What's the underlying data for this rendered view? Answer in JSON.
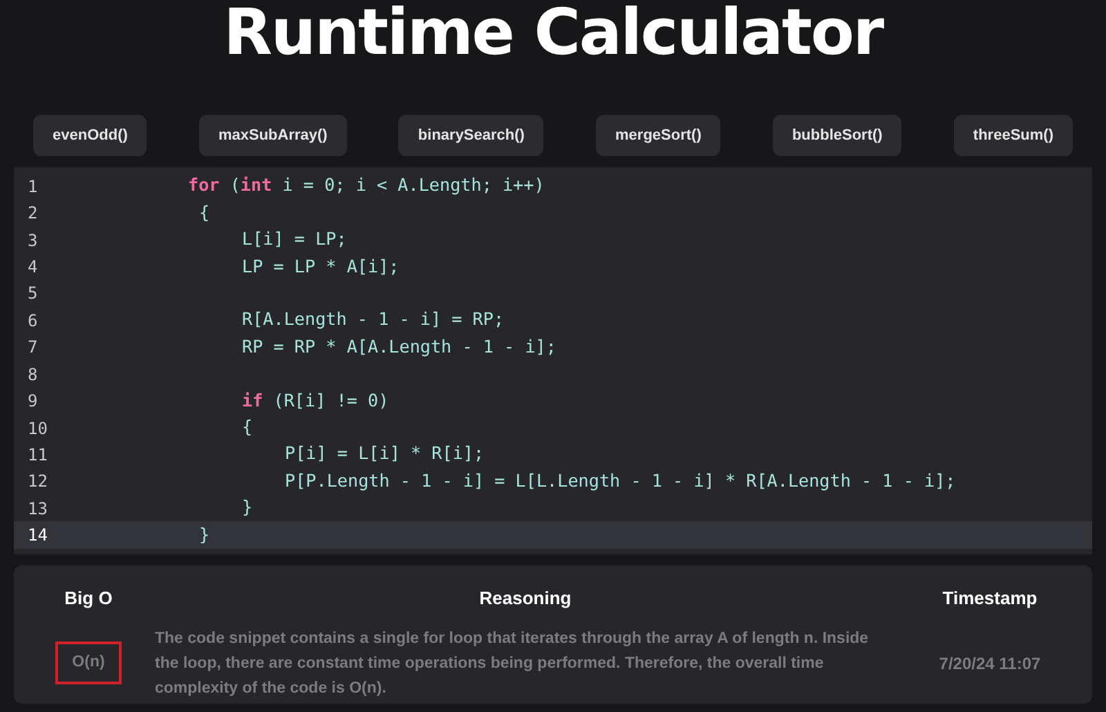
{
  "title": "Runtime Calculator",
  "examples": [
    {
      "label": "evenOdd()"
    },
    {
      "label": "maxSubArray()"
    },
    {
      "label": "binarySearch()"
    },
    {
      "label": "mergeSort()"
    },
    {
      "label": "bubbleSort()"
    },
    {
      "label": "threeSum()"
    }
  ],
  "editor": {
    "lines": [
      {
        "number": "1",
        "current": false,
        "tokens": [
          {
            "kind": "keyword",
            "text": "for"
          },
          {
            "kind": "plain",
            "text": " ("
          },
          {
            "kind": "keyword",
            "text": "int"
          },
          {
            "kind": "plain",
            "text": " i = 0; i < A.Length; i++)"
          }
        ],
        "children": [
          {
            "number": "2",
            "current": false,
            "tokens": [
              {
                "kind": "plain",
                "text": "{"
              }
            ],
            "children": [
              {
                "number": "3",
                "current": false,
                "tokens": [
                  {
                    "kind": "plain",
                    "text": "L[i] = LP;"
                  }
                ]
              },
              {
                "number": "4",
                "current": false,
                "tokens": [
                  {
                    "kind": "plain",
                    "text": "LP = LP * A[i];"
                  }
                ]
              },
              {
                "number": "5",
                "current": false
              },
              {
                "number": "6",
                "current": false,
                "tokens": [
                  {
                    "kind": "plain",
                    "text": "R[A.Length - 1 - i] = RP;"
                  }
                ]
              },
              {
                "number": "7",
                "current": false,
                "tokens": [
                  {
                    "kind": "plain",
                    "text": "RP = RP * A[A.Length - 1 - i];"
                  }
                ]
              },
              {
                "number": "8",
                "current": false
              },
              {
                "number": "9",
                "current": false,
                "tokens": [
                  {
                    "kind": "keyword",
                    "text": "if"
                  },
                  {
                    "kind": "plain",
                    "text": " (R[i] != 0)"
                  }
                ]
              },
              {
                "number": "10",
                "current": false,
                "tokens": [
                  {
                    "kind": "plain",
                    "text": "{"
                  }
                ],
                "children": [
                  {
                    "number": "11",
                    "current": false,
                    "tokens": [
                      {
                        "kind": "plain",
                        "text": "P[i] = L[i] * R[i];"
                      }
                    ]
                  },
                  {
                    "number": "12",
                    "current": false,
                    "tokens": [
                      {
                        "kind": "plain",
                        "text": "P[P.Length - 1 - i] = L[L.Length - 1 - i] * R[A.Length - 1 - i];"
                      }
                    ]
                  }
                ]
              },
              {
                "number": "13",
                "current": false,
                "tokens": [
                  {
                    "kind": "plain",
                    "text": "}"
                  }
                ]
              }
            ]
          },
          {
            "number": "14",
            "current": true,
            "tokens": [
              {
                "kind": "plain",
                "text": "}"
              }
            ]
          }
        ]
      }
    ]
  },
  "results": {
    "columns": [
      "Big O",
      "Reasoning",
      "Timestamp"
    ],
    "rows": [
      {
        "big_o": "O(n)",
        "outlined": true,
        "reasoning": "The code snippet contains a single for loop that iterates through the array A of length n. Inside the loop, there are constant time operations being performed. Therefore, the overall time complexity of the code is O(n).",
        "timestamp": "7/20/24 11:07"
      }
    ]
  }
}
